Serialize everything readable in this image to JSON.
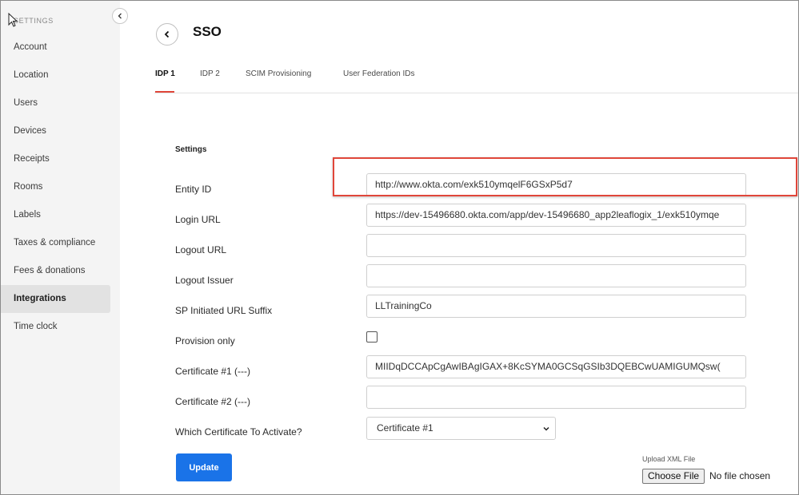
{
  "sidebar": {
    "heading": "SETTINGS",
    "items": [
      {
        "label": "Account"
      },
      {
        "label": "Location"
      },
      {
        "label": "Users"
      },
      {
        "label": "Devices"
      },
      {
        "label": "Receipts"
      },
      {
        "label": "Rooms"
      },
      {
        "label": "Labels"
      },
      {
        "label": "Taxes & compliance"
      },
      {
        "label": "Fees & donations"
      },
      {
        "label": "Integrations",
        "active": true
      },
      {
        "label": "Time clock"
      }
    ]
  },
  "header": {
    "title": "SSO"
  },
  "tabs": [
    {
      "label": "IDP 1",
      "active": true
    },
    {
      "label": "IDP 2"
    },
    {
      "label": "SCIM Provisioning"
    },
    {
      "label": "User Federation IDs"
    }
  ],
  "form": {
    "section_label": "Settings",
    "entity_id": {
      "label": "Entity ID",
      "value": "http://www.okta.com/exk510ymqelF6GSxP5d7"
    },
    "login_url": {
      "label": "Login URL",
      "value": "https://dev-15496680.okta.com/app/dev-15496680_app2leaflogix_1/exk510ymqe"
    },
    "logout_url": {
      "label": "Logout URL",
      "value": ""
    },
    "logout_issuer": {
      "label": "Logout Issuer",
      "value": ""
    },
    "sp_suffix": {
      "label": "SP Initiated URL Suffix",
      "value": "LLTrainingCo"
    },
    "provision_only": {
      "label": "Provision only",
      "checked": false
    },
    "certificate_1": {
      "label": "Certificate #1 (---)",
      "value": "MIIDqDCCApCgAwIBAgIGAX+8KcSYMA0GCSqGSIb3DQEBCwUAMIGUMQsw("
    },
    "certificate_2": {
      "label": "Certificate #2 (---)",
      "value": ""
    },
    "which_cert": {
      "label": "Which Certificate To Activate?",
      "selected": "Certificate #1"
    },
    "update_label": "Update",
    "upload": {
      "label": "Upload XML File",
      "button": "Choose File",
      "status": "No file chosen"
    }
  },
  "colors": {
    "accent": "#1a73e8",
    "tab_active_underline": "#e0463a",
    "highlight_box": "#e0463a",
    "sidebar_bg": "#f4f4f4"
  },
  "icons": {
    "collapse": "chevron-left-icon",
    "back": "chevron-left-icon",
    "select": "chevron-down-icon",
    "cursor": "mouse-pointer-icon"
  }
}
